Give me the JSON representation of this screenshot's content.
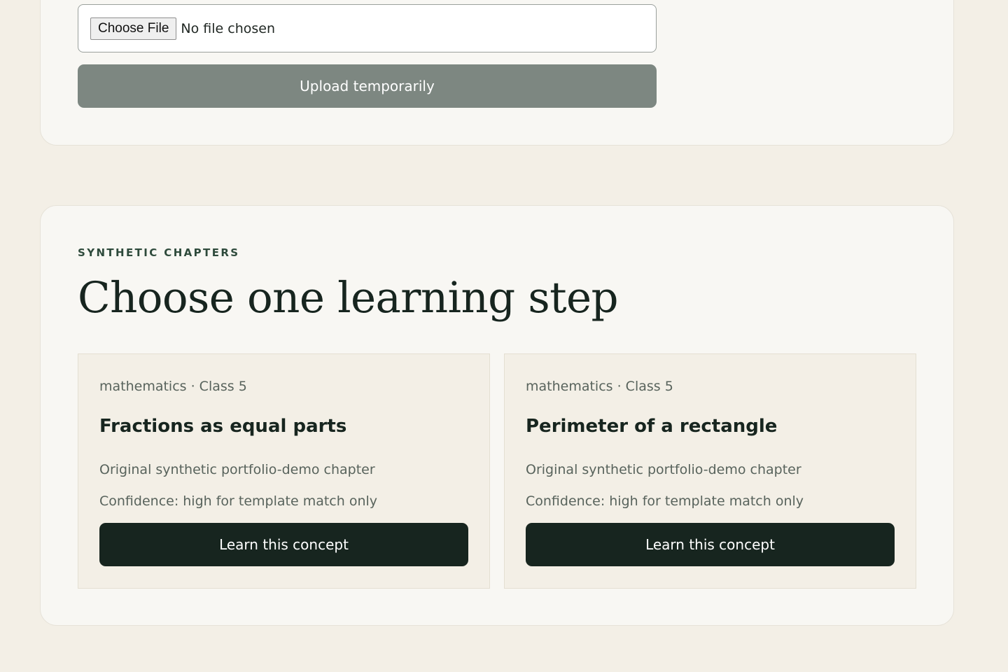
{
  "upload": {
    "file_button_label": "Choose File",
    "file_status": "No file chosen",
    "upload_button_label": "Upload temporarily"
  },
  "chapters": {
    "eyebrow": "SYNTHETIC CHAPTERS",
    "heading": "Choose one learning step",
    "cards": [
      {
        "meta": "mathematics · Class 5",
        "title": "Fractions as equal parts",
        "description": "Original synthetic portfolio-demo chapter",
        "confidence": "Confidence: high for template match only",
        "button_label": "Learn this concept"
      },
      {
        "meta": "mathematics · Class 5",
        "title": "Perimeter of a rectangle",
        "description": "Original synthetic portfolio-demo chapter",
        "confidence": "Confidence: high for template match only",
        "button_label": "Learn this concept"
      }
    ]
  },
  "colors": {
    "page_background": "#f3efe6",
    "panel_background": "#f8f7f3",
    "upload_button": "#7d8781",
    "primary_button": "#17251f",
    "eyebrow_text": "#2e4a3b",
    "muted_text": "#58635c"
  }
}
